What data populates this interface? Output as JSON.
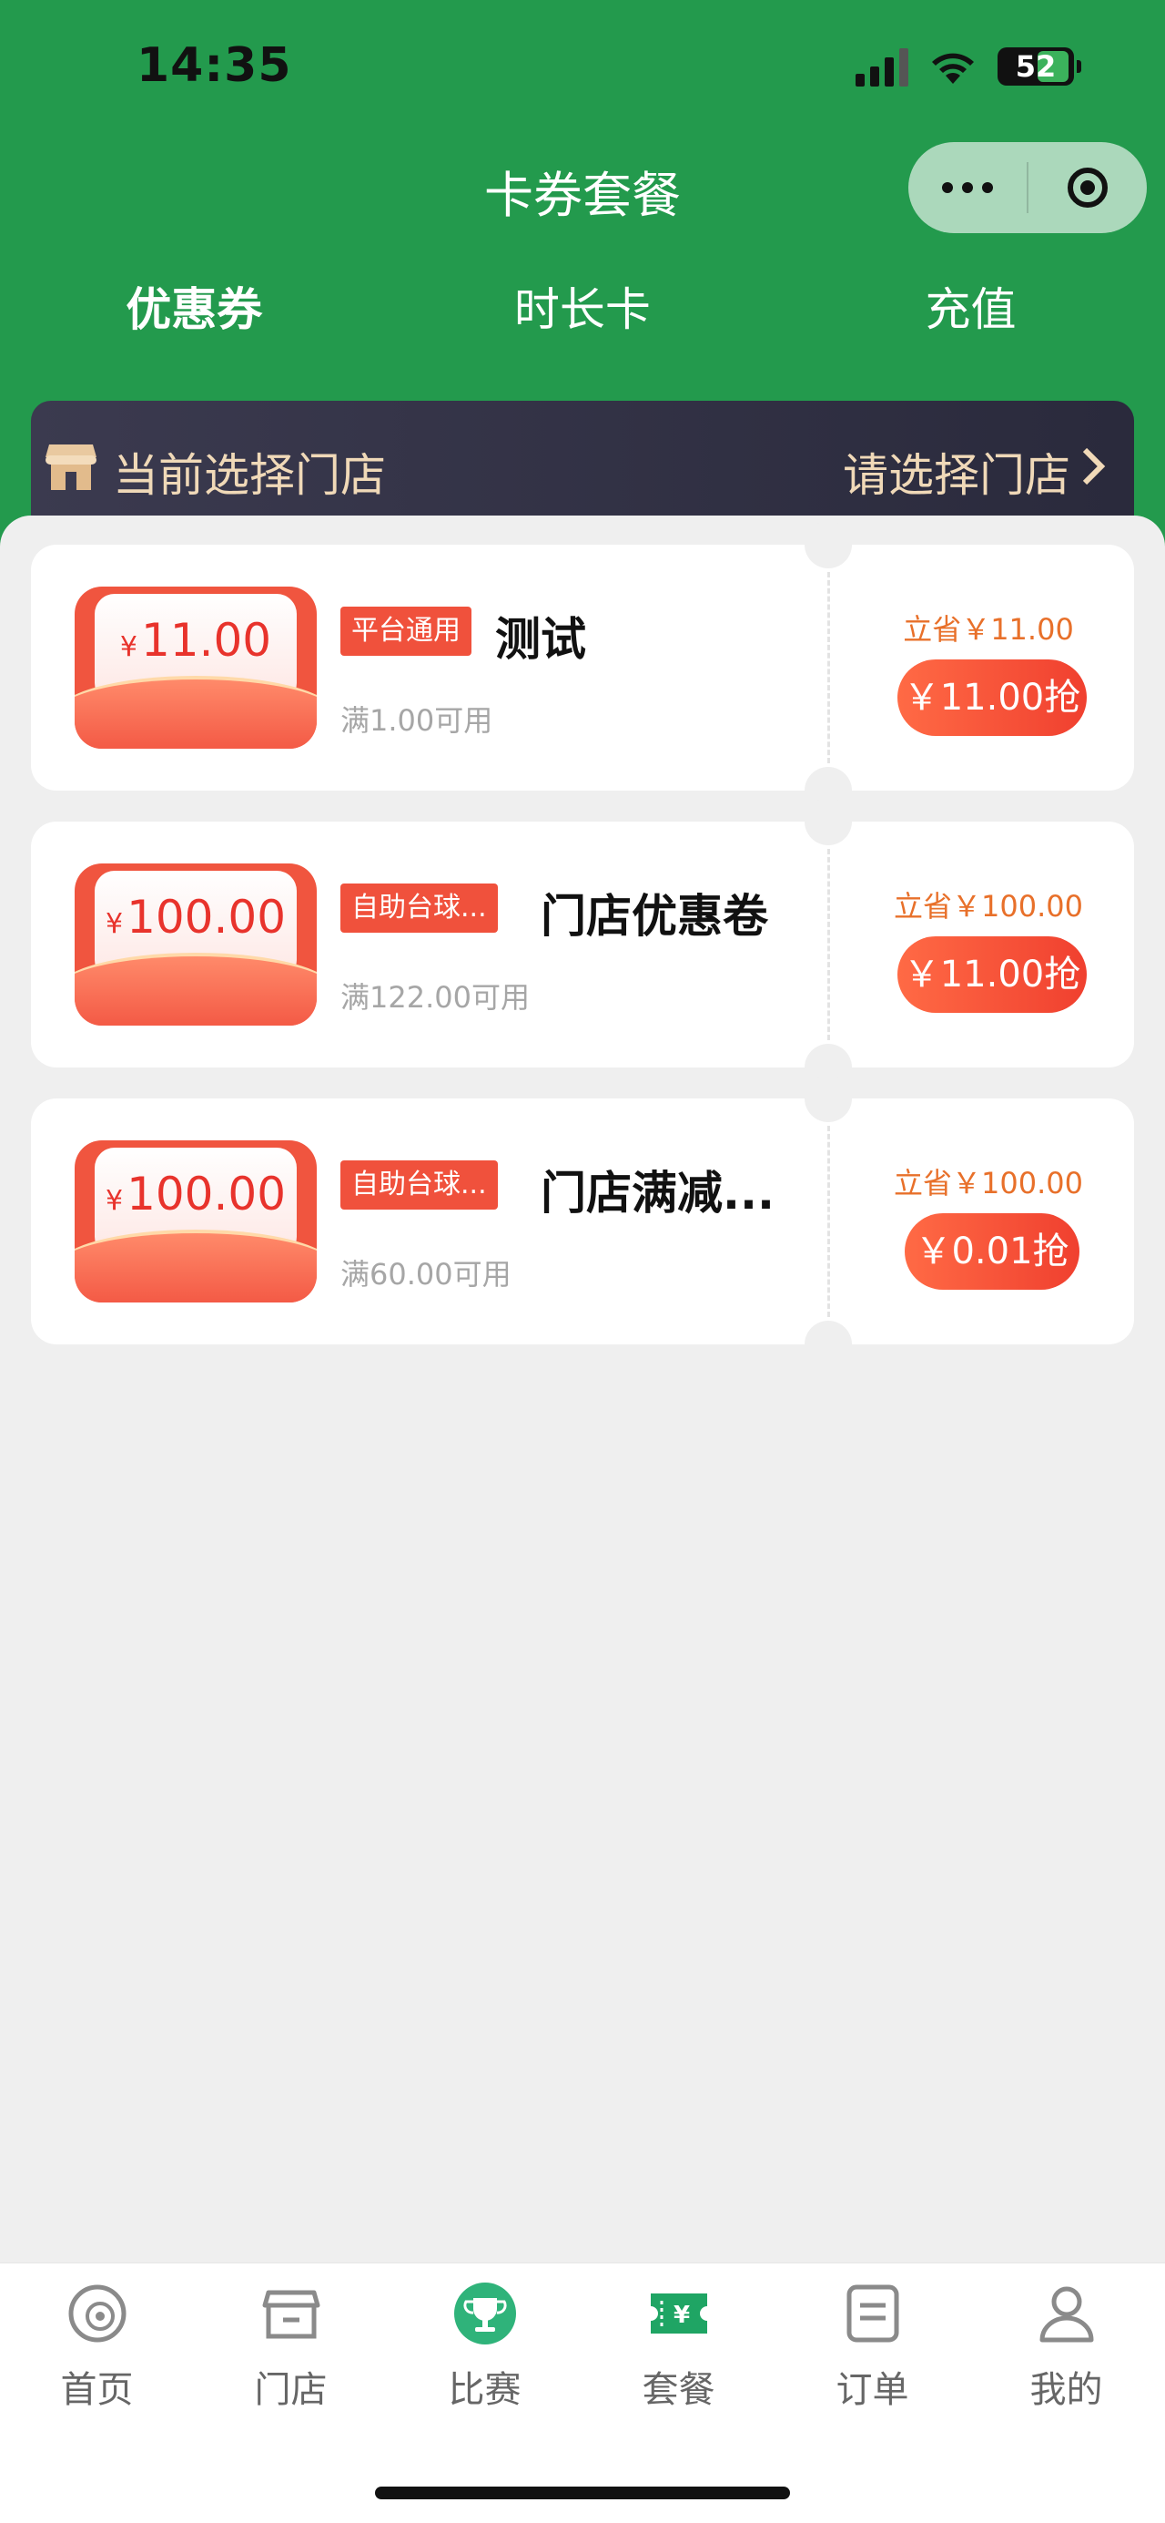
{
  "status_bar": {
    "time": "14:35",
    "battery": "52"
  },
  "header": {
    "title": "卡券套餐"
  },
  "tabs": [
    {
      "label": "优惠券",
      "active": true
    },
    {
      "label": "时长卡",
      "active": false
    },
    {
      "label": "充值",
      "active": false
    }
  ],
  "store_bar": {
    "label": "当前选择门店",
    "select_text": "请选择门店"
  },
  "coupons": [
    {
      "amount": "11.00",
      "yen": "¥",
      "tag": "平台通用",
      "name": "测试",
      "condition": "满1.00可用",
      "save": "立省￥11.00",
      "buy": "￥11.00抢"
    },
    {
      "amount": "100.00",
      "yen": "¥",
      "tag": "自助台球...",
      "name": "门店优惠卷",
      "condition": "满122.00可用",
      "save": "立省￥100.00",
      "buy": "￥11.00抢"
    },
    {
      "amount": "100.00",
      "yen": "¥",
      "tag": "自助台球...",
      "name": "门店满减...",
      "condition": "满60.00可用",
      "save": "立省￥100.00",
      "buy": "￥0.01抢"
    }
  ],
  "tabbar": [
    {
      "label": "首页",
      "icon": "billiard-ball-icon"
    },
    {
      "label": "门店",
      "icon": "store-icon"
    },
    {
      "label": "比赛",
      "icon": "trophy-icon"
    },
    {
      "label": "套餐",
      "icon": "ticket-icon"
    },
    {
      "label": "订单",
      "icon": "order-list-icon"
    },
    {
      "label": "我的",
      "icon": "user-icon"
    }
  ],
  "colors": {
    "header_green": "#239a4d",
    "accent_red": "#f0513c",
    "active_tab_green": "#2fb36a"
  }
}
